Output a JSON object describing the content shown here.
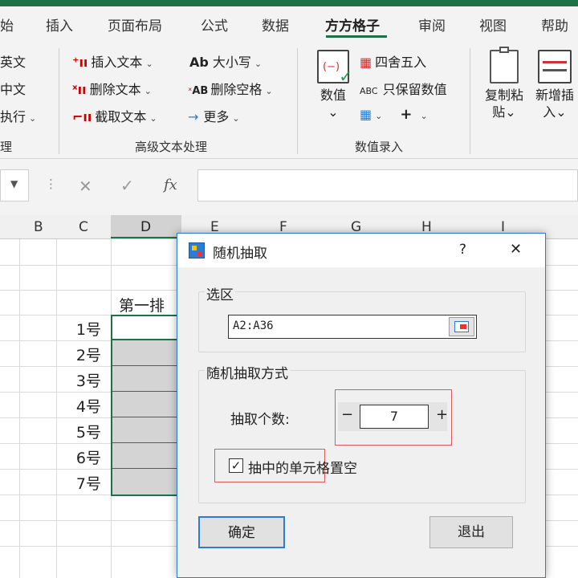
{
  "tabs": [
    "始",
    "插入",
    "页面布局",
    "公式",
    "数据",
    "方方格子",
    "审阅",
    "视图",
    "帮助"
  ],
  "ribbon": {
    "left_partial": [
      "英文",
      "中文",
      "执行",
      "理"
    ],
    "insert_text": "插入文本",
    "delete_text": "删除文本",
    "cut_text": "截取文本",
    "case": "大小写",
    "case_icon_text": "Ab",
    "delete_space": "删除空格",
    "delete_space_icon_text": "AB",
    "more": "更多",
    "group_text": "高级文本处理",
    "number_btn": "数值",
    "round": "四舍五入",
    "keep_number": "只保留数值",
    "keep_number_icon_text": "ABC",
    "group_number": "数值录入",
    "copy_paste": [
      "复制粘",
      "贴"
    ],
    "new_insert": [
      "新增插",
      "入"
    ]
  },
  "formula_bar": {
    "cancel": "✕",
    "confirm": "✓",
    "fx": "fx"
  },
  "columns": [
    "B",
    "C",
    "D",
    "E",
    "F",
    "G",
    "H",
    "I"
  ],
  "sheet": {
    "header_cell": "第一排",
    "rows": [
      "1号",
      "2号",
      "3号",
      "4号",
      "5号",
      "6号",
      "7号"
    ]
  },
  "dialog": {
    "title": "随机抽取",
    "help": "?",
    "close": "✕",
    "selection_group": "选区",
    "range_value": "A2:A36",
    "mode_group": "随机抽取方式",
    "count_label": "抽取个数:",
    "count_value": "7",
    "minus": "−",
    "plus": "+",
    "checkbox_label": "抽中的单元格置空",
    "checkbox_checked": true,
    "ok": "确定",
    "exit": "退出"
  },
  "colors": {
    "excel_green": "#1e7145",
    "highlight_red": "#e05a5a",
    "dialog_border": "#2b7cd6"
  }
}
